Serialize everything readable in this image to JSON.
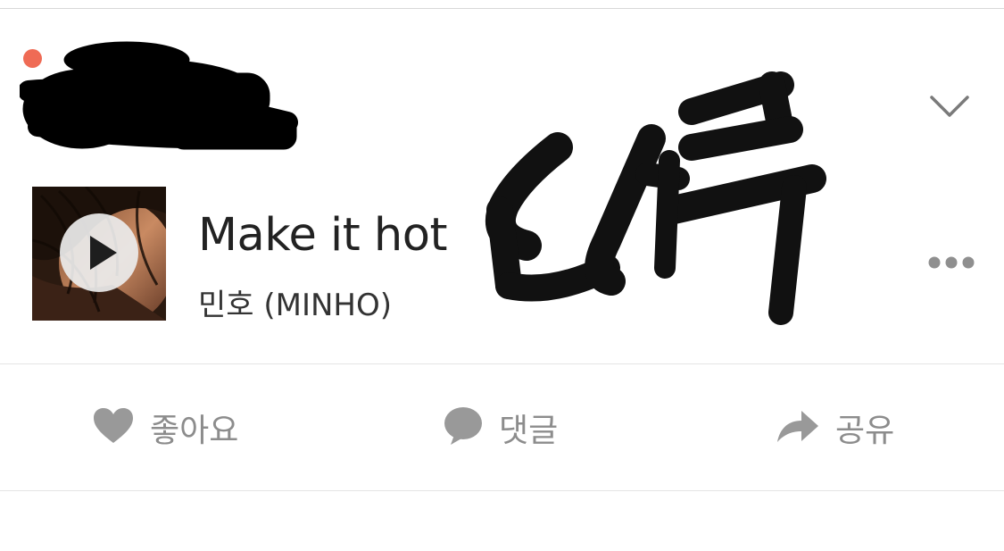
{
  "post": {
    "user": {
      "name_redacted": true,
      "notification_dot_color": "#ef6b55"
    },
    "song": {
      "title": "Make it hot",
      "artist": "민호 (MINHO)"
    },
    "overlay_text": "더쿠",
    "icons": {
      "expand": "chevron-down-icon",
      "more": "more-horizontal-icon",
      "play": "play-icon"
    }
  },
  "actions": {
    "like": {
      "label": "좋아요",
      "icon": "heart-icon"
    },
    "comment": {
      "label": "댓글",
      "icon": "speech-bubble-icon"
    },
    "share": {
      "label": "공유",
      "icon": "share-arrow-icon"
    }
  },
  "colors": {
    "accent_dot": "#ef6b55",
    "action_gray": "#8c8c8c",
    "divider": "#e4e4e4"
  }
}
